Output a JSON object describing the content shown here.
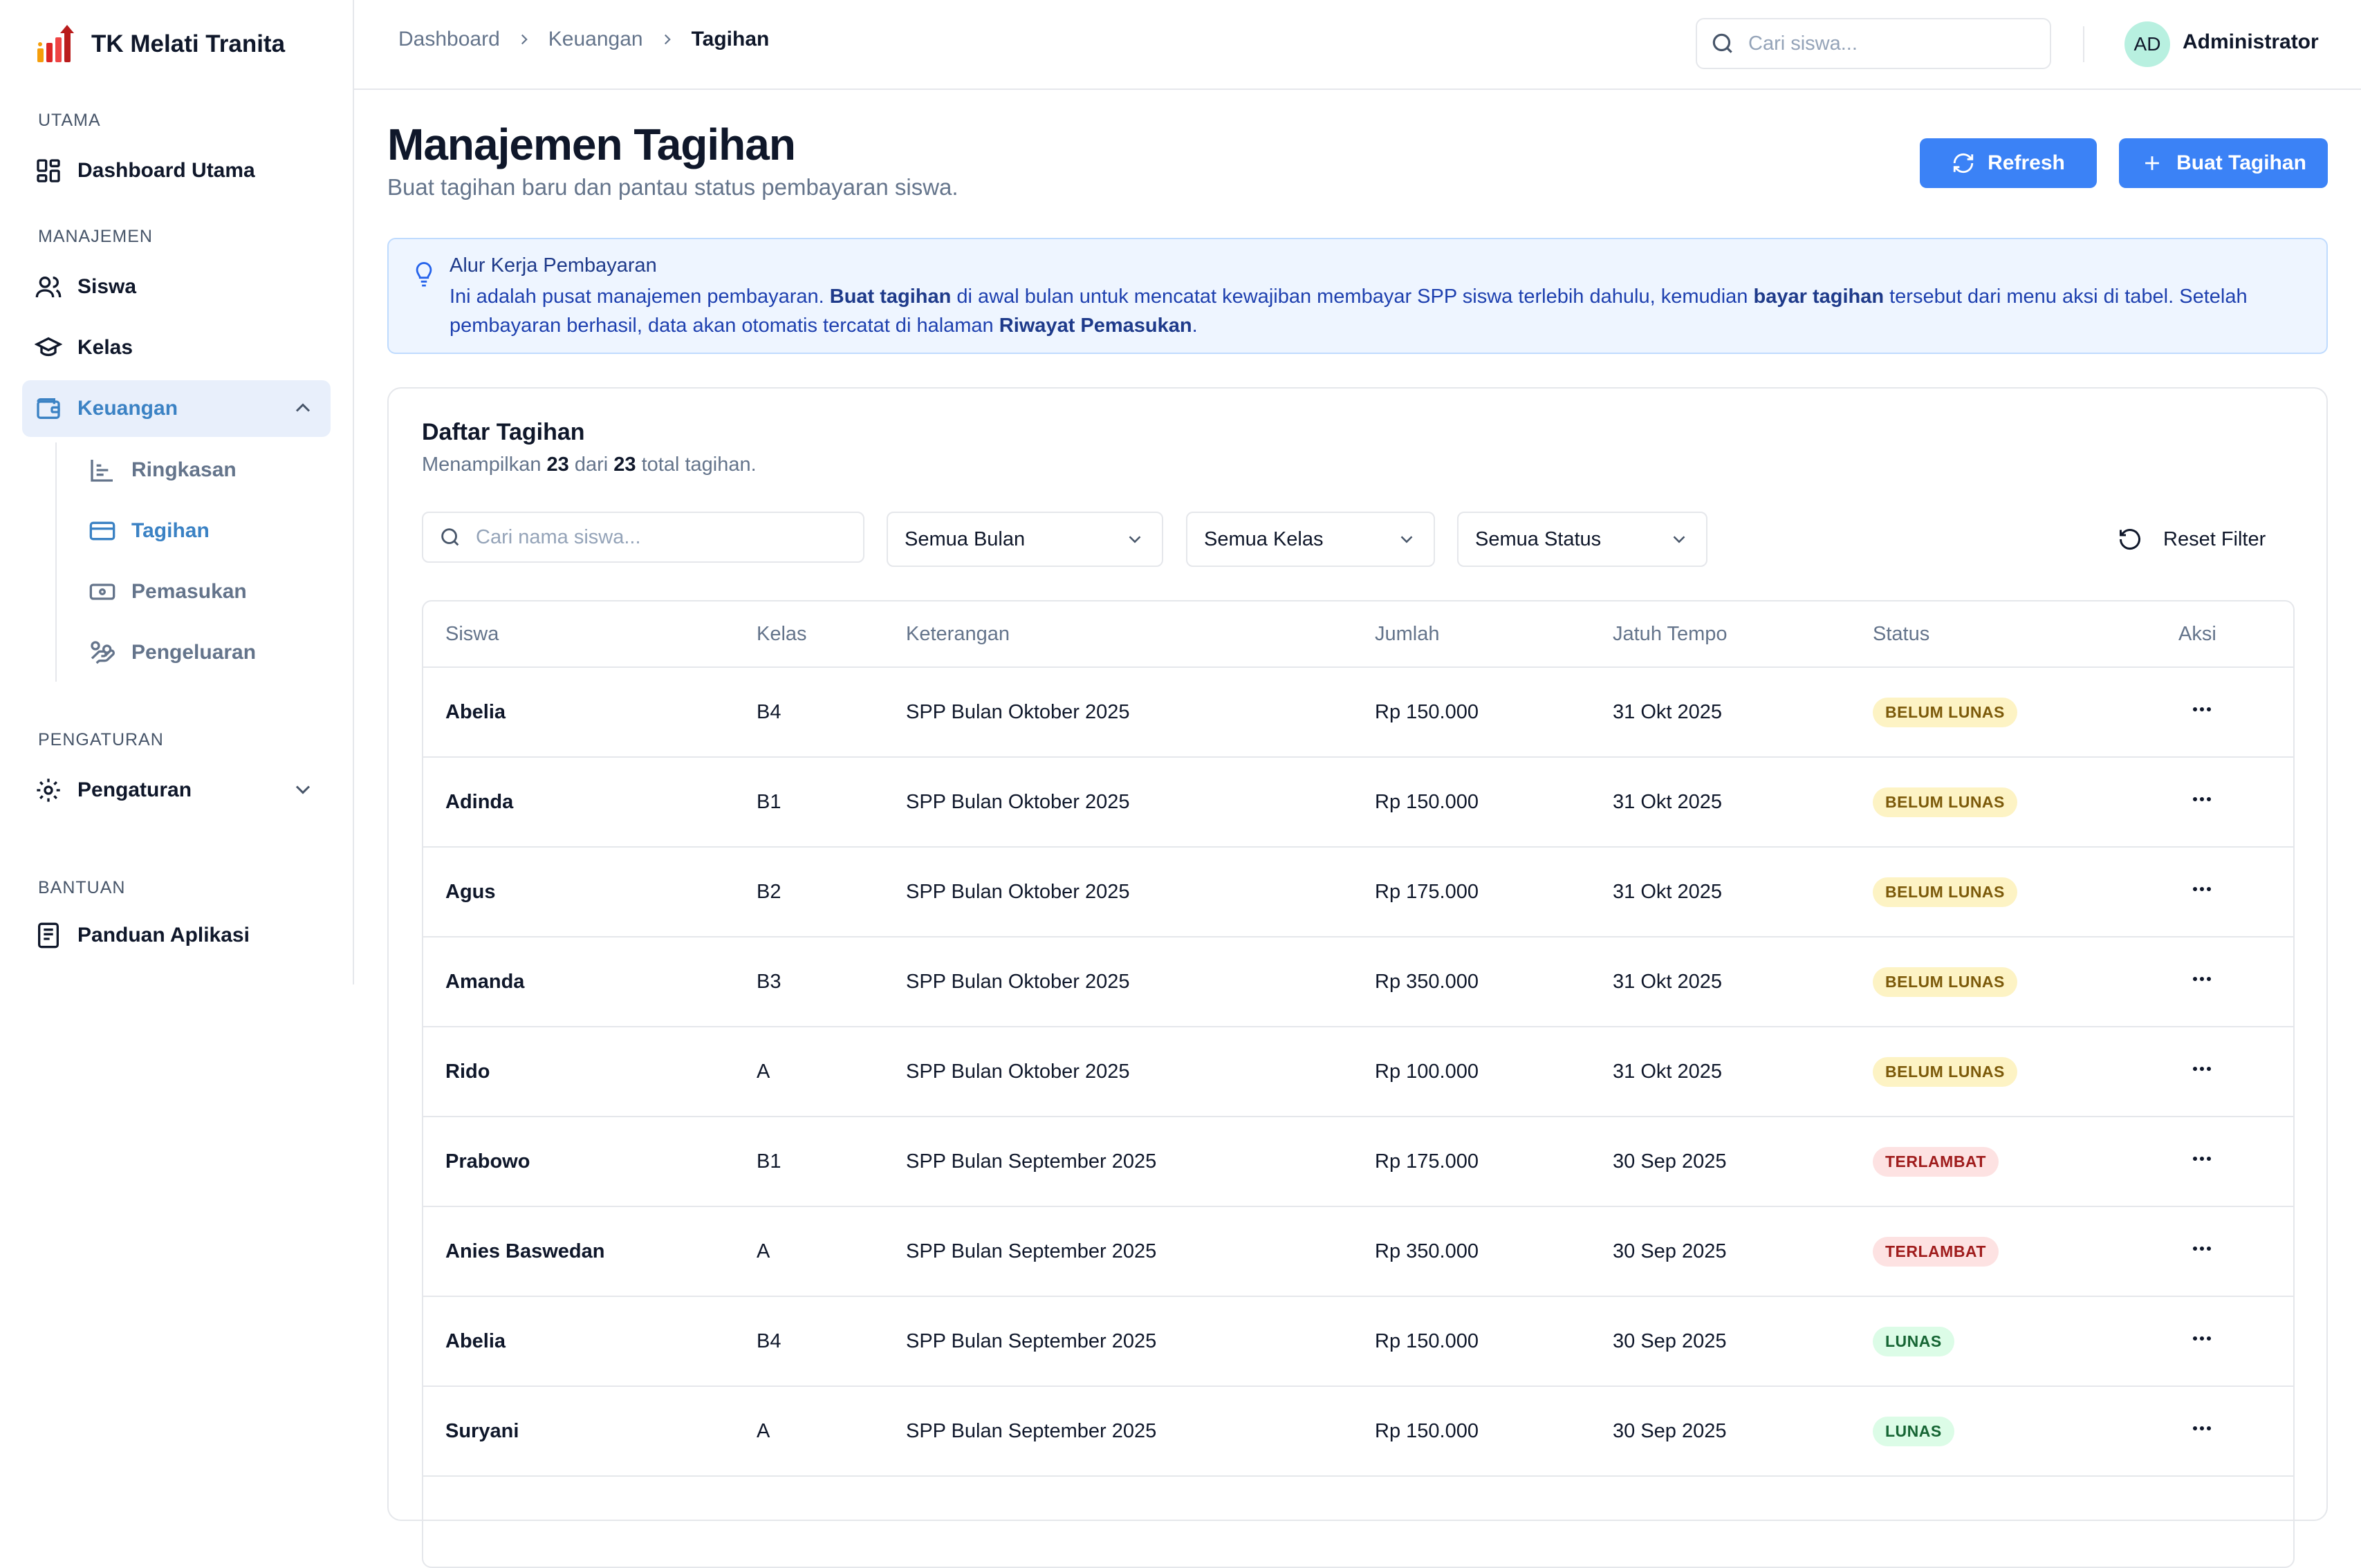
{
  "app": {
    "name": "TK Melati Tranita"
  },
  "sidebar": {
    "sections": {
      "utama": "UTAMA",
      "manajemen": "MANAJEMEN",
      "pengaturan": "PENGATURAN",
      "bantuan": "BANTUAN"
    },
    "items": {
      "dashboard": "Dashboard Utama",
      "siswa": "Siswa",
      "kelas": "Kelas",
      "keuangan": "Keuangan",
      "pengaturan": "Pengaturan",
      "panduan": "Panduan Aplikasi"
    },
    "subitems": {
      "ringkasan": "Ringkasan",
      "tagihan": "Tagihan",
      "pemasukan": "Pemasukan",
      "pengeluaran": "Pengeluaran"
    }
  },
  "header": {
    "breadcrumb": [
      "Dashboard",
      "Keuangan",
      "Tagihan"
    ],
    "search_placeholder": "Cari siswa...",
    "user": {
      "initials": "AD",
      "name": "Administrator"
    }
  },
  "page": {
    "title": "Manajemen Tagihan",
    "subtitle": "Buat tagihan baru dan pantau status pembayaran siswa.",
    "refresh_label": "Refresh",
    "create_label": "Buat Tagihan"
  },
  "info": {
    "title": "Alur Kerja Pembayaran",
    "text_1": "Ini adalah pusat manajemen pembayaran. ",
    "bold_1": "Buat tagihan",
    "text_2": " di awal bulan untuk mencatat kewajiban membayar SPP siswa terlebih dahulu, kemudian ",
    "bold_2": "bayar tagihan",
    "text_3": " tersebut dari menu aksi di tabel. Setelah pembayaran berhasil, data akan otomatis tercatat di halaman ",
    "bold_3": "Riwayat Pemasukan",
    "text_4": "."
  },
  "list": {
    "title": "Daftar Tagihan",
    "summary_prefix": "Menampilkan ",
    "shown": "23",
    "summary_mid": " dari ",
    "total": "23",
    "summary_suffix": " total tagihan.",
    "search_placeholder": "Cari nama siswa...",
    "filter_month": "Semua Bulan",
    "filter_class": "Semua Kelas",
    "filter_status": "Semua Status",
    "reset_label": "Reset Filter",
    "columns": [
      "Siswa",
      "Kelas",
      "Keterangan",
      "Jumlah",
      "Jatuh Tempo",
      "Status",
      "Aksi"
    ],
    "rows": [
      {
        "siswa": "Abelia",
        "kelas": "B4",
        "keterangan": "SPP Bulan Oktober 2025",
        "jumlah": "Rp 150.000",
        "tempo": "31 Okt 2025",
        "status": "BELUM LUNAS",
        "kind": "unpaid"
      },
      {
        "siswa": "Adinda",
        "kelas": "B1",
        "keterangan": "SPP Bulan Oktober 2025",
        "jumlah": "Rp 150.000",
        "tempo": "31 Okt 2025",
        "status": "BELUM LUNAS",
        "kind": "unpaid"
      },
      {
        "siswa": "Agus",
        "kelas": "B2",
        "keterangan": "SPP Bulan Oktober 2025",
        "jumlah": "Rp 175.000",
        "tempo": "31 Okt 2025",
        "status": "BELUM LUNAS",
        "kind": "unpaid"
      },
      {
        "siswa": "Amanda",
        "kelas": "B3",
        "keterangan": "SPP Bulan Oktober 2025",
        "jumlah": "Rp 350.000",
        "tempo": "31 Okt 2025",
        "status": "BELUM LUNAS",
        "kind": "unpaid"
      },
      {
        "siswa": "Rido",
        "kelas": "A",
        "keterangan": "SPP Bulan Oktober 2025",
        "jumlah": "Rp 100.000",
        "tempo": "31 Okt 2025",
        "status": "BELUM LUNAS",
        "kind": "unpaid"
      },
      {
        "siswa": "Prabowo",
        "kelas": "B1",
        "keterangan": "SPP Bulan September 2025",
        "jumlah": "Rp 175.000",
        "tempo": "30 Sep 2025",
        "status": "TERLAMBAT",
        "kind": "late"
      },
      {
        "siswa": "Anies Baswedan",
        "kelas": "A",
        "keterangan": "SPP Bulan September 2025",
        "jumlah": "Rp 350.000",
        "tempo": "30 Sep 2025",
        "status": "TERLAMBAT",
        "kind": "late"
      },
      {
        "siswa": "Abelia",
        "kelas": "B4",
        "keterangan": "SPP Bulan September 2025",
        "jumlah": "Rp 150.000",
        "tempo": "30 Sep 2025",
        "status": "LUNAS",
        "kind": "paid"
      },
      {
        "siswa": "Suryani",
        "kelas": "A",
        "keterangan": "SPP Bulan September 2025",
        "jumlah": "Rp 150.000",
        "tempo": "30 Sep 2025",
        "status": "LUNAS",
        "kind": "paid"
      }
    ]
  },
  "colors": {
    "accent": "#3b82f6",
    "active_nav": "#3b82c4",
    "unpaid": "#fdf3c4",
    "late": "#fde2e2",
    "paid": "#dcfce7"
  }
}
